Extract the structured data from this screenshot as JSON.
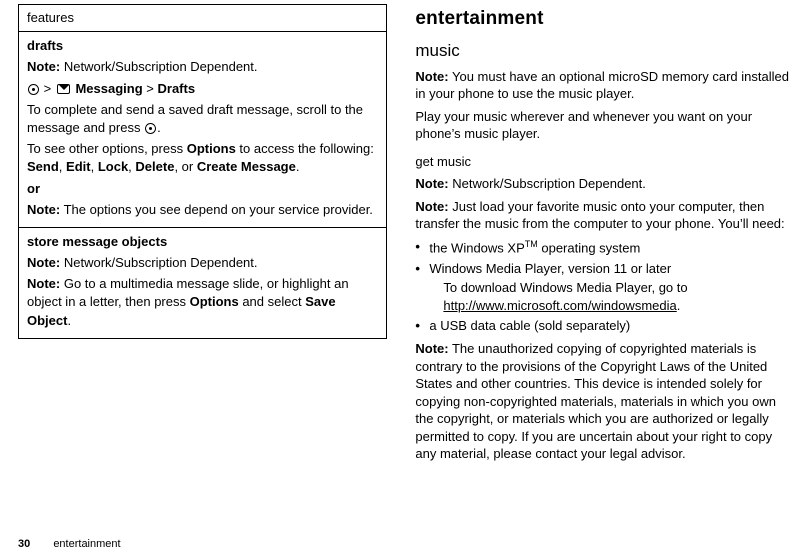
{
  "footer": {
    "page_number": "30",
    "section": "entertainment"
  },
  "left": {
    "features_header": "features",
    "drafts": {
      "title": "drafts",
      "note1_label": "Note:",
      "note1_text": "Network/Subscription Dependent.",
      "nav_pre": ">",
      "nav_mid": "Messaging",
      "nav_sep": ">",
      "nav_end": "Drafts",
      "p1": "To complete and send a saved draft message, scroll to the message and press ",
      "p1_tail": ".",
      "p2_pre": "To see other options, press ",
      "p2_options": "Options",
      "p2_mid": " to access the following: ",
      "opt_send": "Send",
      "opt_edit": "Edit",
      "opt_lock": "Lock",
      "opt_delete": "Delete",
      "opt_or": ", or ",
      "opt_create": "Create Message",
      "p2_tail": ".",
      "or_label": "or",
      "note2_label": "Note:",
      "note2_text": "The options you see depend on your service provider."
    },
    "store": {
      "title": "store message objects",
      "note1_label": "Note:",
      "note1_text": "Network/Subscription Dependent.",
      "note2_label": "Note:",
      "note2_pre": "Go to a multimedia message slide, or highlight an object in a letter, then press ",
      "note2_options": "Options",
      "note2_mid": " and select ",
      "note2_action": "Save Object",
      "note2_tail": "."
    }
  },
  "right": {
    "h1": "entertainment",
    "music_h2": "music",
    "note_must_label": "Note:",
    "note_must_text": "You must have an optional microSD memory card installed in your phone to use the music player.",
    "play_text": "Play your music wherever and whenever you want on your phone’s music player.",
    "get_music": "get music",
    "note_net_label": "Note:",
    "note_net_text": "Network/Subscription Dependent.",
    "note_load_label": "Note:",
    "note_load_text": "Just load your favorite music onto your computer, then transfer the music from the computer to your phone. You’ll need:",
    "bullet_xp_pre": "the Windows XP",
    "bullet_xp_tm": "TM",
    "bullet_xp_post": " operating system",
    "bullet_wmp": "Windows Media Player, version 11 or later",
    "bullet_wmp_sub_pre": "To download Windows Media Player, go to ",
    "bullet_wmp_link": "http://www.microsoft.com/windowsmedia",
    "bullet_wmp_sub_post": ".",
    "bullet_usb": "a USB data cable (sold separately)",
    "note_copy_label": "Note:",
    "note_copy_text": "The unauthorized copying of copyrighted materials is contrary to the provisions of the Copyright Laws of the United States and other countries. This device is intended solely for copying non-copyrighted materials, materials in which you own the copyright, or materials which you are authorized or legally permitted to copy. If you are uncertain about your right to copy any material, please contact your legal advisor."
  }
}
